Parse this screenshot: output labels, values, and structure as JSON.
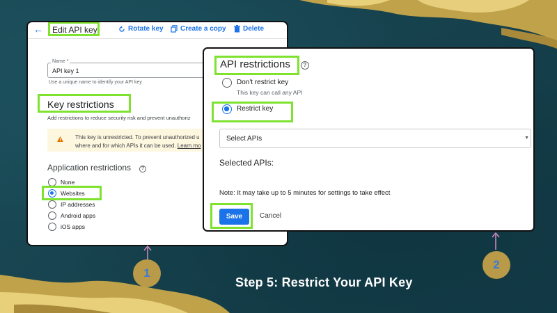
{
  "colors": {
    "highlight": "#7ee22e",
    "accent": "#1a73e8",
    "background": "#16404a",
    "step_circle": "#b99a48"
  },
  "panel1": {
    "topbar": {
      "title": "Edit API key",
      "rotate_label": "Rotate key",
      "copy_label": "Create a copy",
      "delete_label": "Delete"
    },
    "name": {
      "label": "Name *",
      "value": "API key 1",
      "hint": "Use a unique name to identify your API key"
    },
    "key_restrictions": {
      "title": "Key restrictions",
      "description": "Add restrictions to reduce security risk and prevent unauthoriz",
      "warning_line1": "This key is unrestricted. To prevent unauthorized u",
      "warning_line2": "where and for which APIs it can be used.",
      "warning_link": "Learn mo"
    },
    "application_restrictions": {
      "title": "Application restrictions",
      "options": [
        "None",
        "Websites",
        "IP addresses",
        "Android apps",
        "iOS apps"
      ],
      "selected": "Websites"
    }
  },
  "panel2": {
    "title": "API restrictions",
    "dont_restrict_label": "Don't restrict key",
    "dont_restrict_sub": "This key can call any API",
    "restrict_label": "Restrict key",
    "select_placeholder": "Select APIs",
    "selected_apis_label": "Selected APIs:",
    "note": "Note: It may take up to 5 minutes for settings to take effect",
    "save_label": "Save",
    "cancel_label": "Cancel"
  },
  "steps": {
    "one": "1",
    "two": "2"
  },
  "caption": "Step 5: Restrict Your API Key"
}
